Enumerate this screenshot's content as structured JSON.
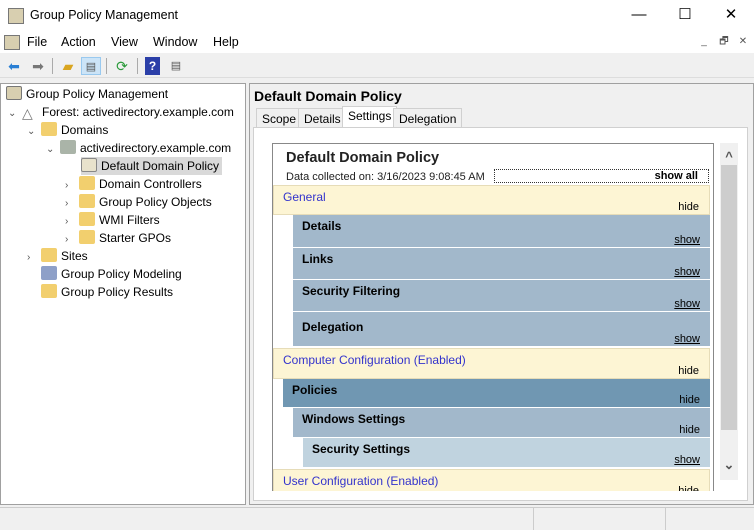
{
  "window": {
    "title": "Group Policy Management",
    "minimize": "—",
    "maximize": "☐",
    "close": "✕"
  },
  "menu": [
    "File",
    "Action",
    "View",
    "Window",
    "Help"
  ],
  "mdi": [
    "_",
    "🗗",
    "✕"
  ],
  "toolbar": {
    "icons": [
      "back-icon",
      "forward-icon",
      "up-folder-icon",
      "show-hide-tree-icon",
      "refresh-icon",
      "help-icon",
      "action-pane-icon"
    ]
  },
  "tree": {
    "root": "Group Policy Management",
    "forest": "Forest: activedirectory.example.com",
    "domains": "Domains",
    "domain": "activedirectory.example.com",
    "items": [
      "Default Domain Policy",
      "Domain Controllers",
      "Group Policy Objects",
      "WMI Filters",
      "Starter GPOs"
    ],
    "sites": "Sites",
    "modeling": "Group Policy Modeling",
    "results": "Group Policy Results"
  },
  "right": {
    "title": "Default Domain Policy",
    "tabs": [
      "Scope",
      "Details",
      "Settings",
      "Delegation"
    ],
    "active_tab": "Settings"
  },
  "report": {
    "title": "Default Domain Policy",
    "collected": "Data collected on: 3/16/2023 9:08:45 AM",
    "show_all": "show all",
    "sections": [
      {
        "label": "General",
        "action": "hide"
      },
      {
        "label": "Details",
        "action": "show"
      },
      {
        "label": "Links",
        "action": "show"
      },
      {
        "label": "Security Filtering",
        "action": "show"
      },
      {
        "label": "Delegation",
        "action": "show"
      },
      {
        "label": "Computer Configuration (Enabled)",
        "action": "hide"
      },
      {
        "label": "Policies",
        "action": "hide"
      },
      {
        "label": "Windows Settings",
        "action": "hide"
      },
      {
        "label": "Security Settings",
        "action": "show"
      },
      {
        "label": "User Configuration (Enabled)",
        "action": "hide"
      }
    ]
  },
  "colors": {
    "cream": "#fdf5d4",
    "link": "#3333cc",
    "level0": "#7097b2",
    "level1": "#a2b8cb",
    "level2": "#c0d3df"
  }
}
